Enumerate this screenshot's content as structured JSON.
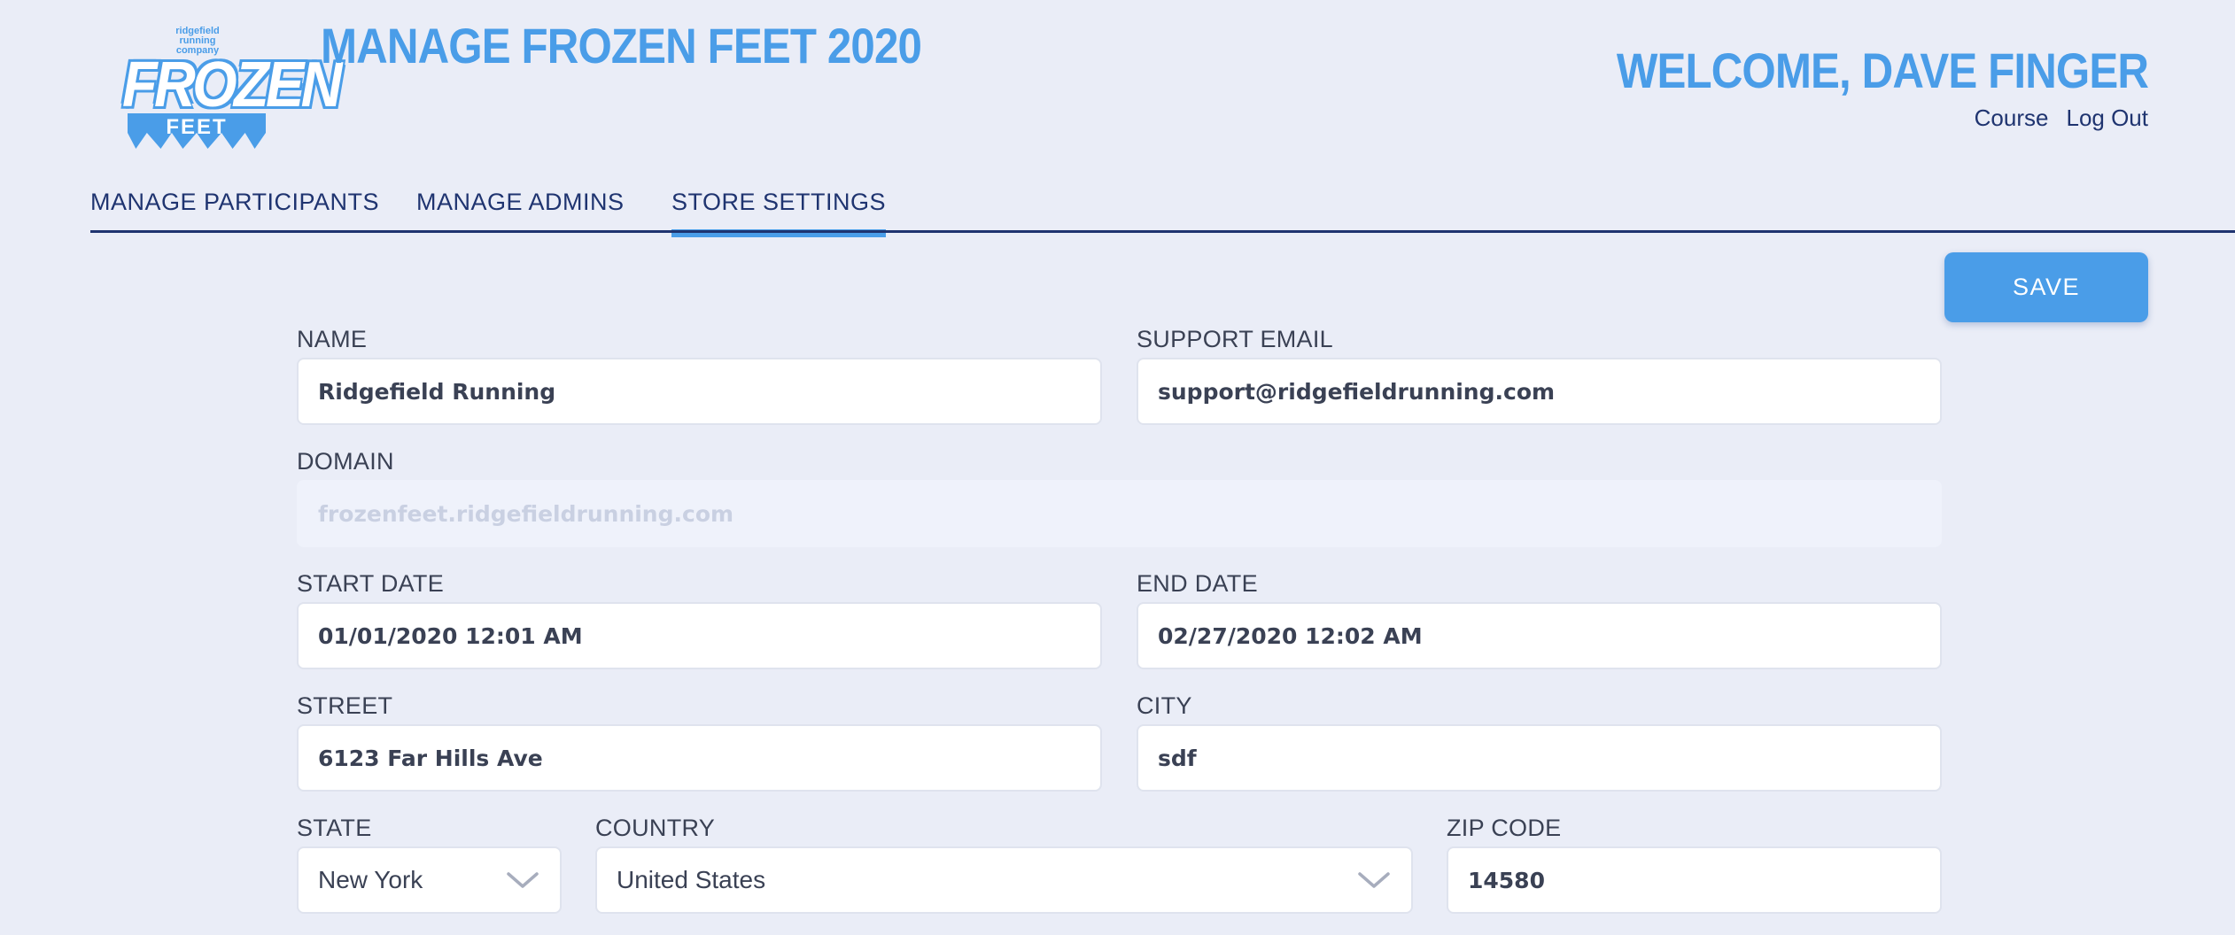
{
  "header": {
    "logo": {
      "tagline": "ridgefield running company",
      "word": "FROZEN",
      "sub": "FEET"
    },
    "title": "MANAGE FROZEN FEET 2020",
    "welcome": "WELCOME, DAVE FINGER",
    "links": {
      "course": "Course",
      "logout": "Log Out"
    }
  },
  "tabs": [
    {
      "label": "MANAGE PARTICIPANTS",
      "active": false
    },
    {
      "label": "MANAGE ADMINS",
      "active": false
    },
    {
      "label": "STORE SETTINGS",
      "active": true
    }
  ],
  "toolbar": {
    "save_label": "SAVE"
  },
  "form": {
    "name": {
      "label": "NAME",
      "value": "Ridgefield Running"
    },
    "support_email": {
      "label": "SUPPORT EMAIL",
      "value": "support@ridgefieldrunning.com"
    },
    "domain": {
      "label": "DOMAIN",
      "value": "frozenfeet.ridgefieldrunning.com",
      "disabled": true
    },
    "start_date": {
      "label": "START DATE",
      "value": "01/01/2020 12:01 AM"
    },
    "end_date": {
      "label": "END DATE",
      "value": "02/27/2020 12:02 AM"
    },
    "street": {
      "label": "STREET",
      "value": "6123 Far Hills Ave"
    },
    "city": {
      "label": "CITY",
      "value": "sdf"
    },
    "state": {
      "label": "STATE",
      "value": "New York"
    },
    "country": {
      "label": "COUNTRY",
      "value": "United States"
    },
    "zip": {
      "label": "ZIP CODE",
      "value": "14580"
    }
  },
  "colors": {
    "accent": "#4a9de8",
    "navy": "#1f3470",
    "background": "#eaedf7"
  }
}
